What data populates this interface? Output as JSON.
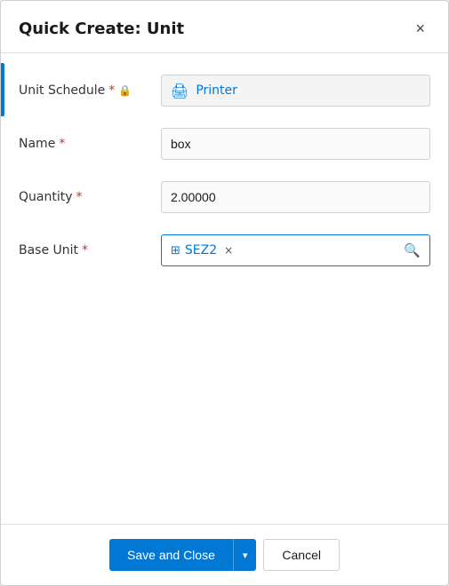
{
  "dialog": {
    "title": "Quick Create: Unit",
    "close_label": "×"
  },
  "form": {
    "unit_schedule": {
      "label": "Unit Schedule",
      "required": "*",
      "value": "Printer",
      "icon": "🖨"
    },
    "name": {
      "label": "Name",
      "required": "*",
      "value": "box"
    },
    "quantity": {
      "label": "Quantity",
      "required": "*",
      "value": "2.00000"
    },
    "base_unit": {
      "label": "Base Unit",
      "required": "*",
      "tag_text": "SEZ2",
      "tag_icon": "⊞"
    }
  },
  "footer": {
    "save_close_label": "Save and Close",
    "dropdown_icon": "▾",
    "cancel_label": "Cancel"
  }
}
